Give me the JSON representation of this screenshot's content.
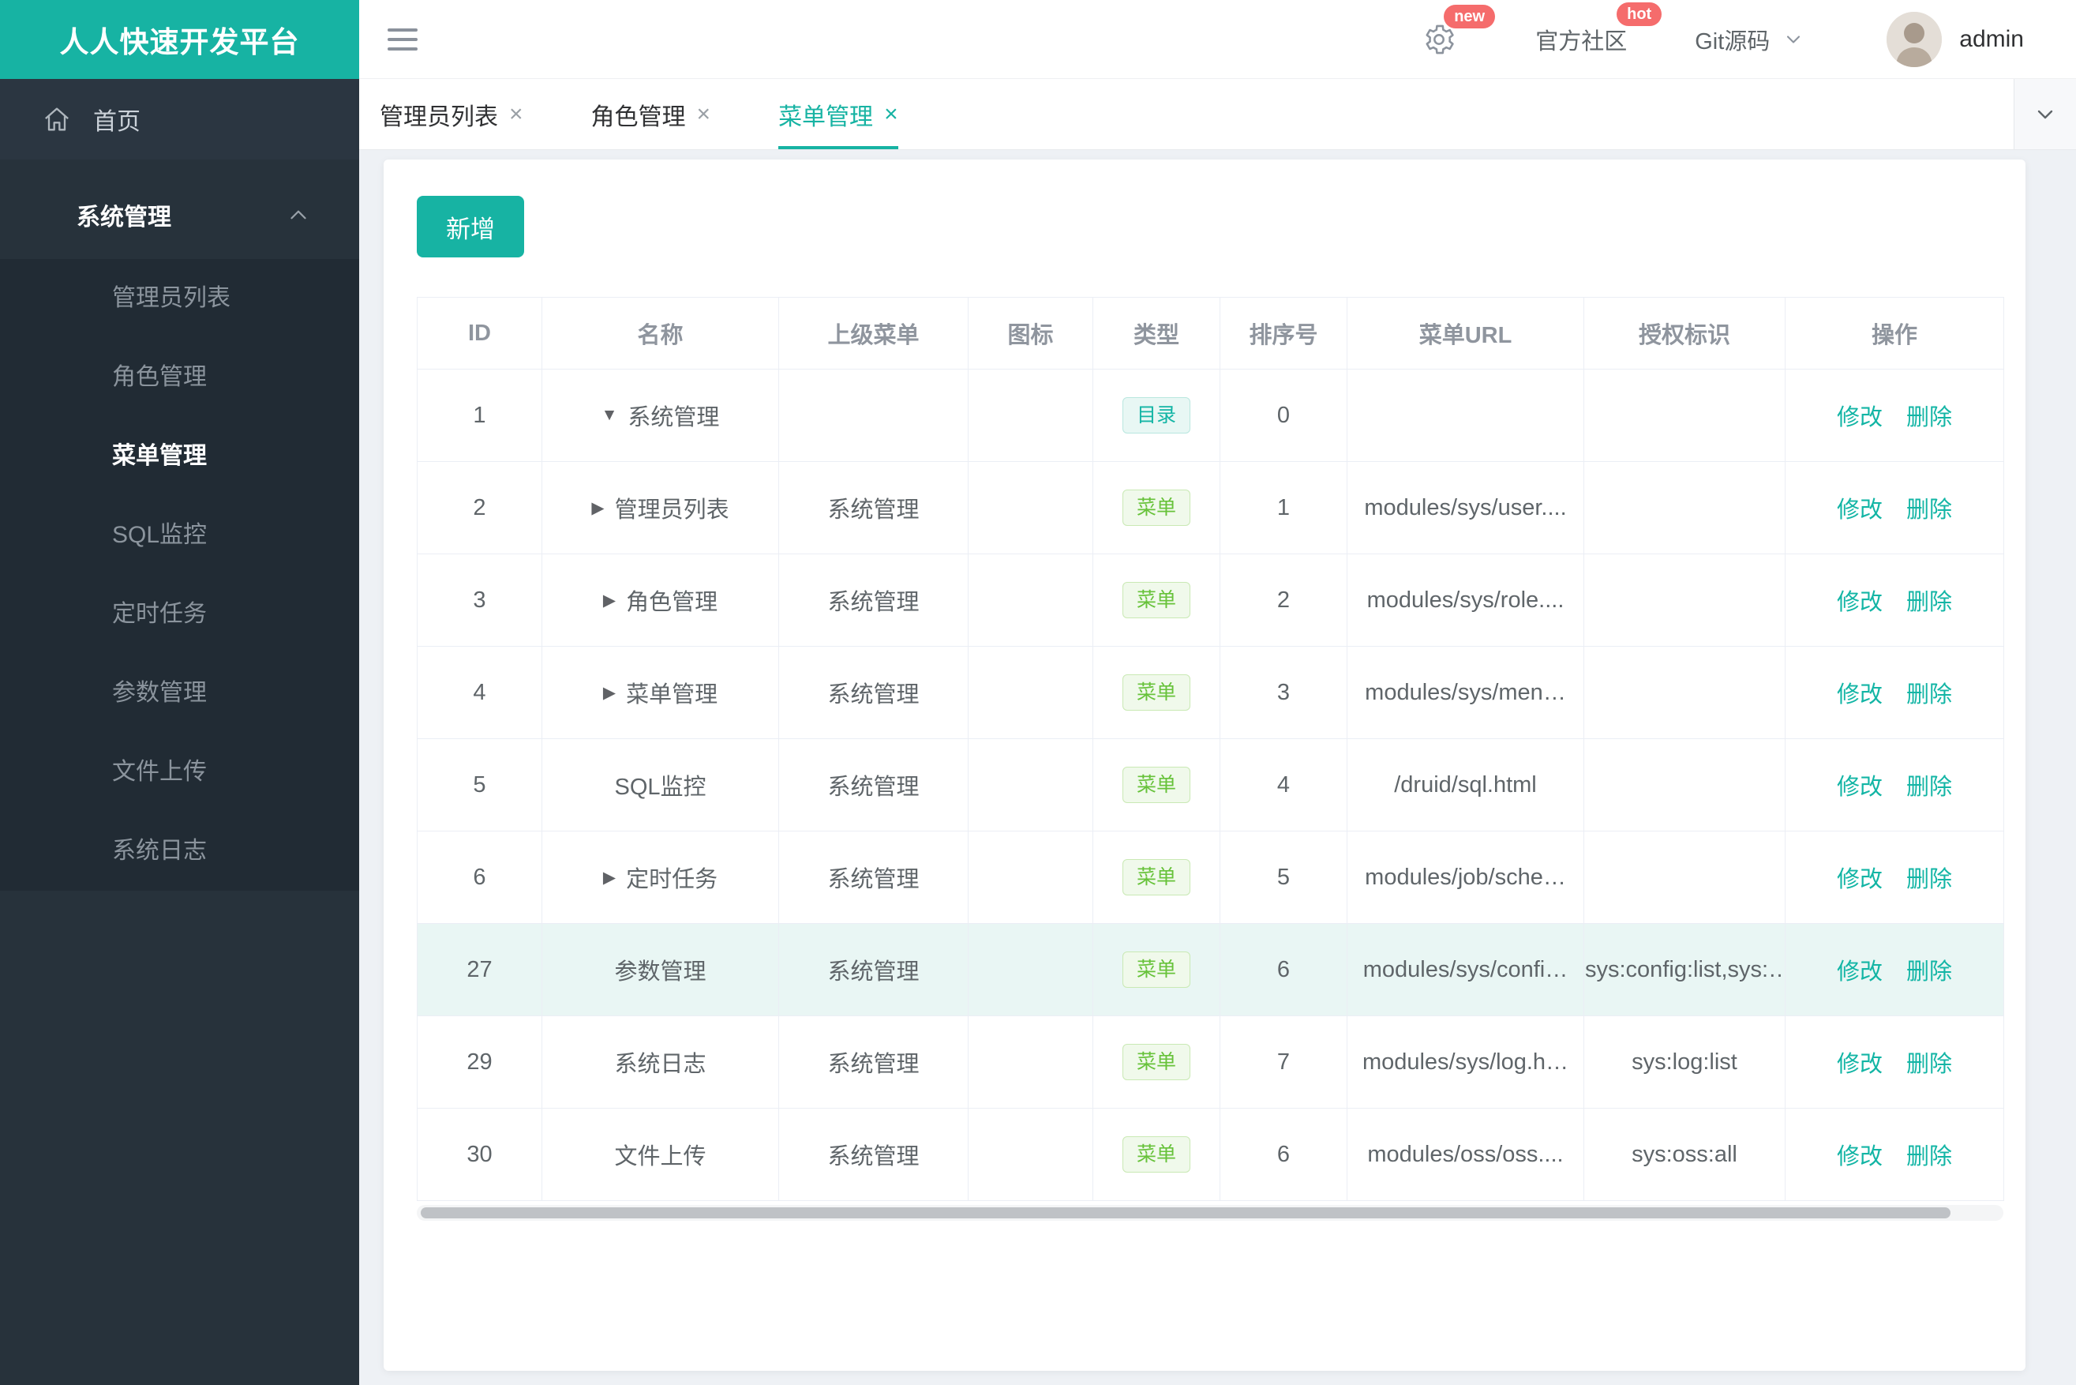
{
  "brand": {
    "title": "人人快速开发平台"
  },
  "colors": {
    "brand": "#17B3A3",
    "link": "#13B5A5",
    "green": "#67C23A",
    "badge": "#F56C6C",
    "hl": "#E9F6F4",
    "side-base": "#27323B",
    "side-sub": "#212B34"
  },
  "topbar": {
    "badge_new": "new",
    "badge_hot": "hot",
    "community_label": "官方社区",
    "git_label": "Git源码",
    "username": "admin"
  },
  "sidebar": {
    "home_label": "首页",
    "section_label": "系统管理",
    "items": [
      {
        "label": "管理员列表",
        "active": false
      },
      {
        "label": "角色管理",
        "active": false
      },
      {
        "label": "菜单管理",
        "active": true
      },
      {
        "label": "SQL监控",
        "active": false
      },
      {
        "label": "定时任务",
        "active": false
      },
      {
        "label": "参数管理",
        "active": false
      },
      {
        "label": "文件上传",
        "active": false
      },
      {
        "label": "系统日志",
        "active": false
      }
    ]
  },
  "tabs": [
    {
      "label": "管理员列表",
      "active": false
    },
    {
      "label": "角色管理",
      "active": false
    },
    {
      "label": "菜单管理",
      "active": true
    }
  ],
  "content": {
    "add_button_label": "新增",
    "table": {
      "headers": [
        "ID",
        "名称",
        "上级菜单",
        "图标",
        "类型",
        "排序号",
        "菜单URL",
        "授权标识",
        "操作"
      ],
      "action_labels": [
        "修改",
        "删除"
      ],
      "rows": [
        {
          "id": "1",
          "arrow": "down",
          "name": "系统管理",
          "parent": "",
          "icon": "",
          "type": "目录",
          "order": "0",
          "url": "",
          "auth": "",
          "highlighted": false
        },
        {
          "id": "2",
          "arrow": "right",
          "name": "管理员列表",
          "parent": "系统管理",
          "icon": "",
          "type": "菜单",
          "order": "1",
          "url": "modules/sys/user....",
          "auth": "",
          "highlighted": false
        },
        {
          "id": "3",
          "arrow": "right",
          "name": "角色管理",
          "parent": "系统管理",
          "icon": "",
          "type": "菜单",
          "order": "2",
          "url": "modules/sys/role....",
          "auth": "",
          "highlighted": false
        },
        {
          "id": "4",
          "arrow": "right",
          "name": "菜单管理",
          "parent": "系统管理",
          "icon": "",
          "type": "菜单",
          "order": "3",
          "url": "modules/sys/men…",
          "auth": "",
          "highlighted": false
        },
        {
          "id": "5",
          "arrow": "",
          "name": "SQL监控",
          "parent": "系统管理",
          "icon": "",
          "type": "菜单",
          "order": "4",
          "url": "/druid/sql.html",
          "auth": "",
          "highlighted": false
        },
        {
          "id": "6",
          "arrow": "right",
          "name": "定时任务",
          "parent": "系统管理",
          "icon": "",
          "type": "菜单",
          "order": "5",
          "url": "modules/job/sche…",
          "auth": "",
          "highlighted": false
        },
        {
          "id": "27",
          "arrow": "",
          "name": "参数管理",
          "parent": "系统管理",
          "icon": "",
          "type": "菜单",
          "order": "6",
          "url": "modules/sys/confi…",
          "auth": "sys:config:list,sys:…",
          "highlighted": true
        },
        {
          "id": "29",
          "arrow": "",
          "name": "系统日志",
          "parent": "系统管理",
          "icon": "",
          "type": "菜单",
          "order": "7",
          "url": "modules/sys/log.h…",
          "auth": "sys:log:list",
          "highlighted": false
        },
        {
          "id": "30",
          "arrow": "",
          "name": "文件上传",
          "parent": "系统管理",
          "icon": "",
          "type": "菜单",
          "order": "6",
          "url": "modules/oss/oss....",
          "auth": "sys:oss:all",
          "highlighted": false
        }
      ]
    }
  }
}
